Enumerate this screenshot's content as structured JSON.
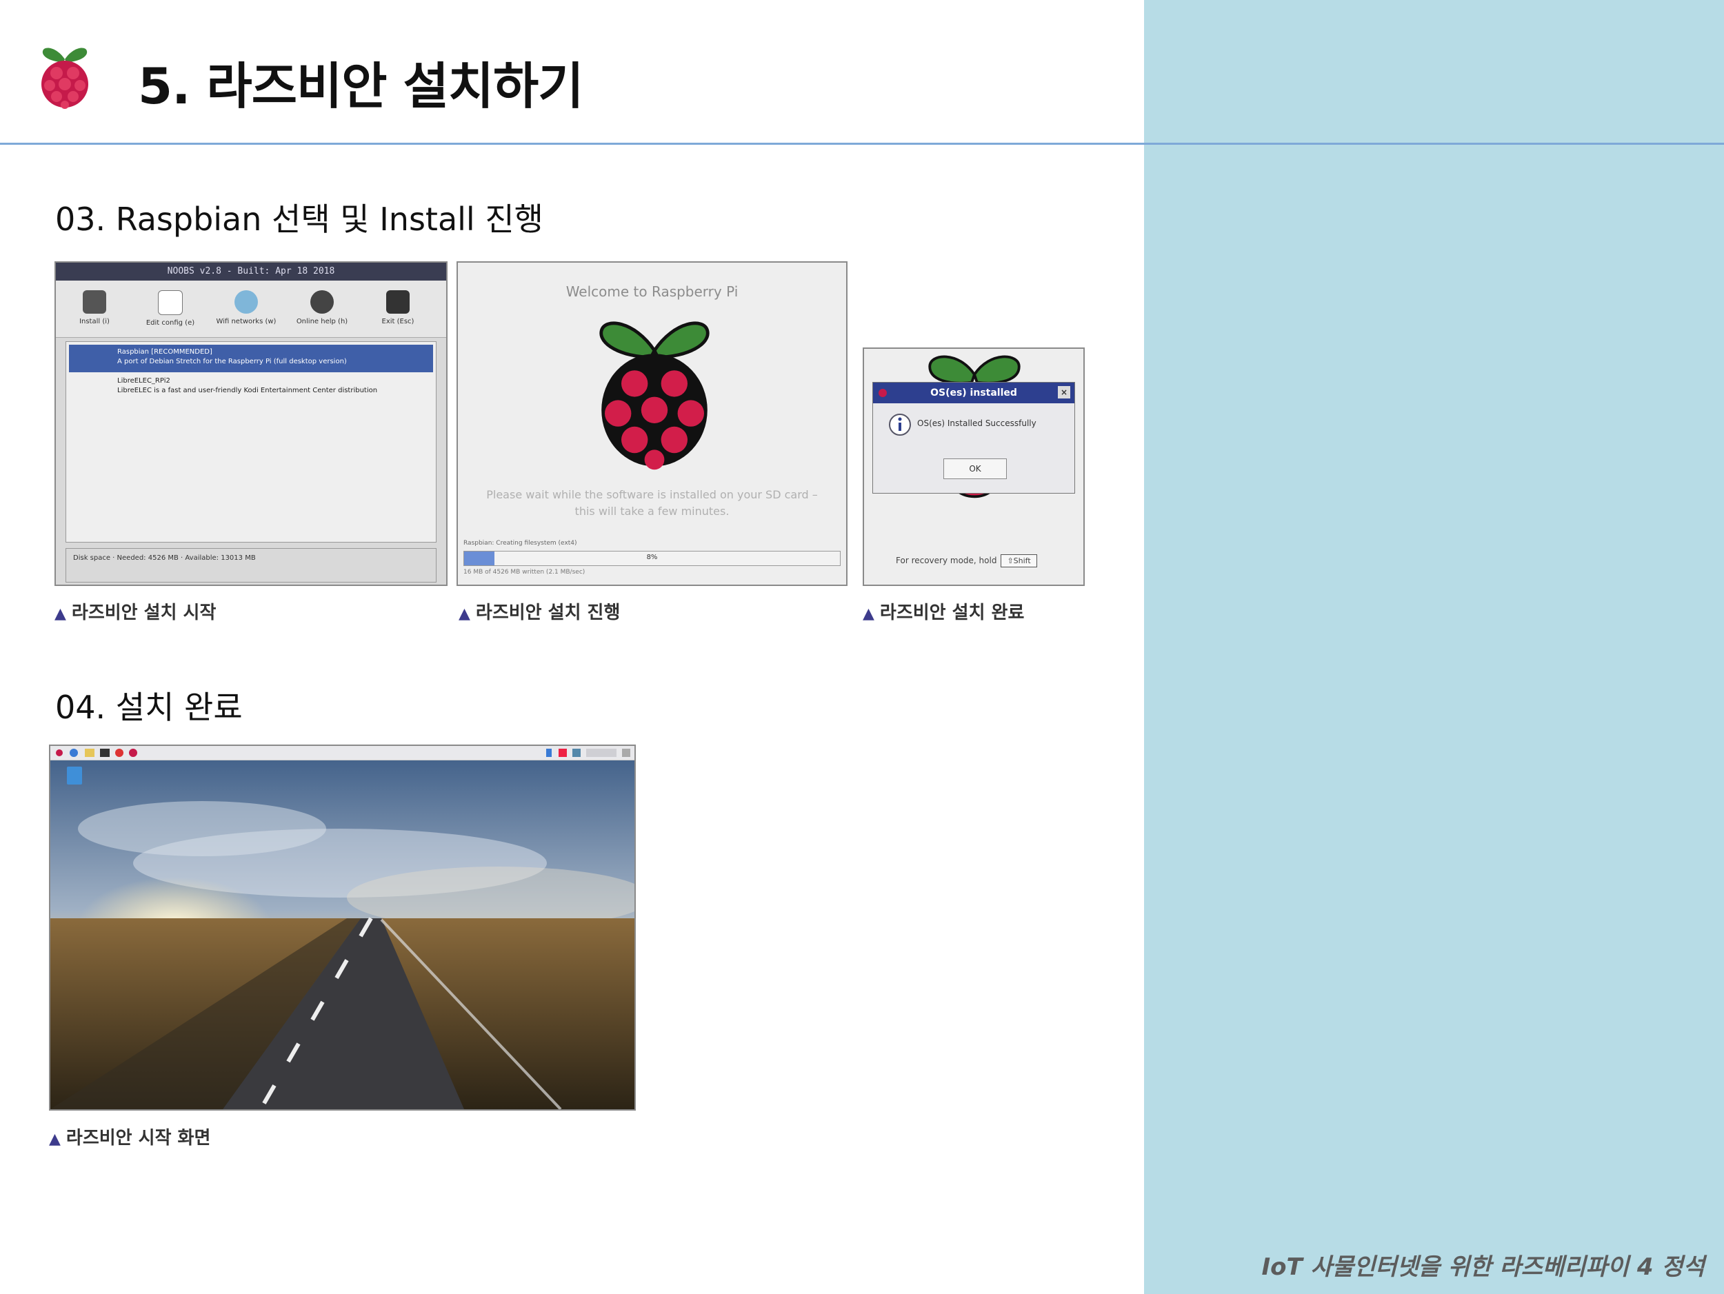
{
  "header": {
    "title": "5. 라즈비안 설치하기",
    "logo_icon": "raspberry-pi-logo-icon"
  },
  "sections": [
    {
      "title": "03. Raspbian 선택 및 Install 진행"
    },
    {
      "title": "04. 설치 완료"
    }
  ],
  "captions": {
    "install_start": "라즈비안 설치 시작",
    "install_progress": "라즈비안 설치 진행",
    "install_done": "라즈비안 설치 완료",
    "desktop": "라즈비안 시작 화면",
    "marker": "▲"
  },
  "noobs": {
    "title": "NOOBS v2.8 - Built: Apr 18 2018",
    "tools": [
      "Install (i)",
      "Edit config (e)",
      "Wifi networks (w)",
      "Online help (h)",
      "Exit (Esc)"
    ],
    "os_list": [
      {
        "name": "Raspbian [RECOMMENDED]",
        "desc": "A port of Debian Stretch for the Raspberry Pi (full desktop version)"
      },
      {
        "name": "LibreELEC_RPi2",
        "desc": "LibreELEC is a fast and user-friendly Kodi Entertainment Center distribution"
      }
    ],
    "disk_label": "Disk space",
    "needed": "Needed: 4526 MB",
    "available": "Available: 13013 MB"
  },
  "welcome": {
    "title": "Welcome to Raspberry Pi",
    "wait": "Please wait while the software is installed on your SD card – this will take a few minutes.",
    "progress_label": "Raspbian: Creating filesystem (ext4)",
    "progress_value": 0.08,
    "progress_text": "8%",
    "progress_sub": "16 MB of 4526 MB written (2.1 MB/sec)"
  },
  "installed": {
    "dialog_title": "OS(es) installed",
    "message": "OS(es) Installed Successfully",
    "ok": "OK",
    "recovery": "For recovery mode, hold",
    "shift": "⇧Shift"
  },
  "footer": {
    "text": "IoT 사물인터넷을 위한 라즈베리파이 4 정석"
  },
  "colors": {
    "side_panel": "#b7dce6",
    "rule": "#7ea9d8",
    "raspberry": "#c51a4a",
    "leaf": "#3d8b37"
  }
}
